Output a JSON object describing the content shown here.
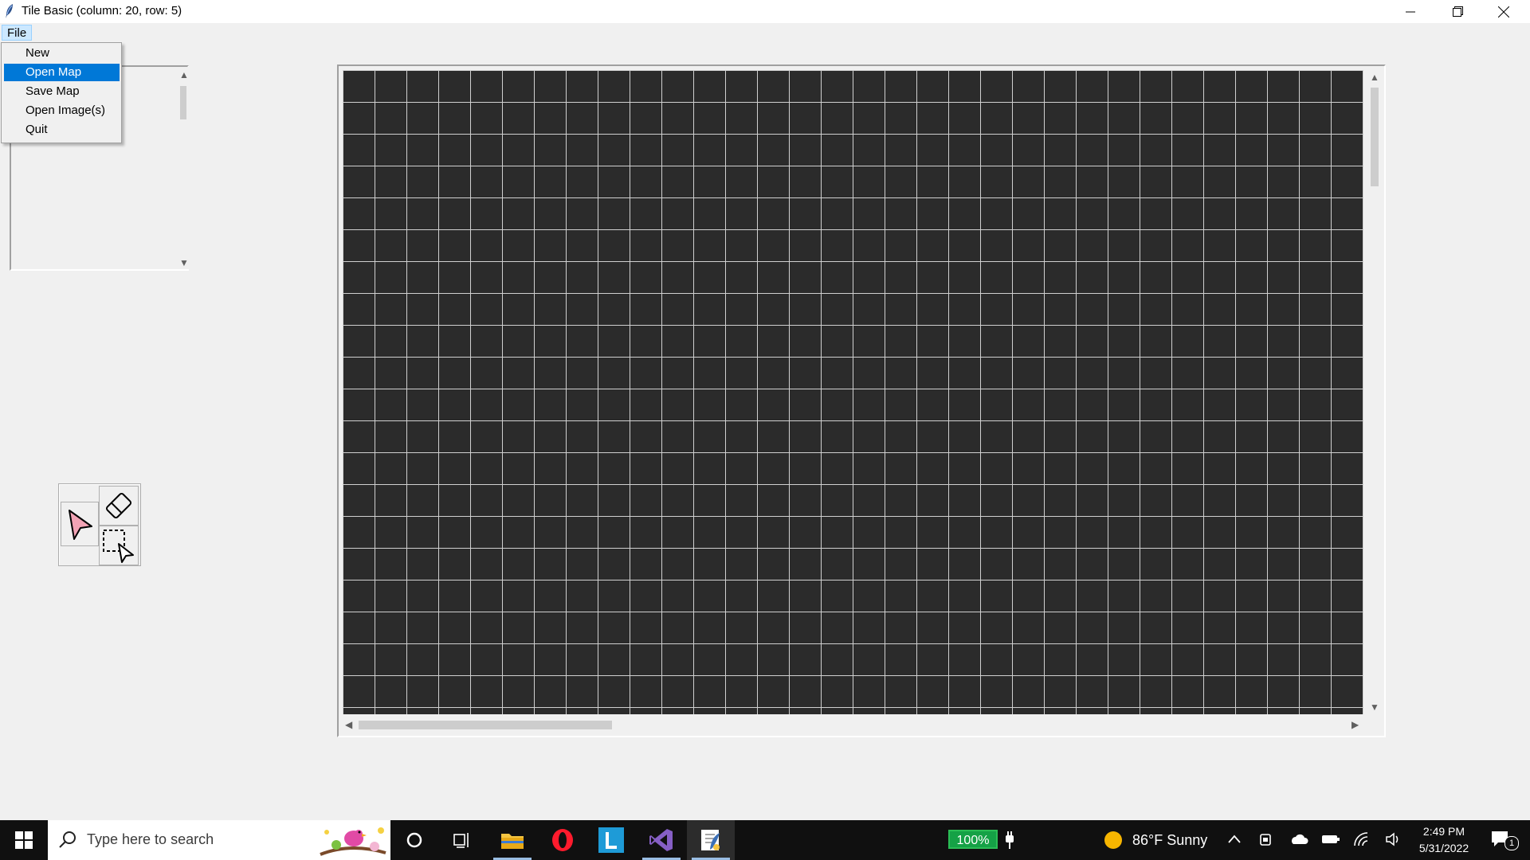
{
  "window": {
    "title": "Tile Basic (column: 20, row: 5)"
  },
  "menubar": {
    "file_label": "File"
  },
  "file_menu": {
    "items": [
      {
        "label": "New"
      },
      {
        "label": "Open Map",
        "selected": true
      },
      {
        "label": "Save Map"
      },
      {
        "label": "Open Image(s)"
      },
      {
        "label": "Quit"
      }
    ]
  },
  "tools": {
    "icons": [
      "pointer-tool-icon",
      "eraser-tool-icon",
      "select-tool-icon"
    ]
  },
  "map": {
    "grid_background": "#2b2b2b",
    "grid_line_color": "#d0d0d0"
  },
  "taskbar": {
    "search_placeholder": "Type here to search",
    "battery_label": "100%",
    "weather_text": "86°F  Sunny",
    "time": "2:49 PM",
    "date": "5/31/2022",
    "notification_count": "1"
  },
  "colors": {
    "menu_highlight": "#0078d7",
    "taskbar_bg": "#101010",
    "battery_green": "#15a146"
  }
}
